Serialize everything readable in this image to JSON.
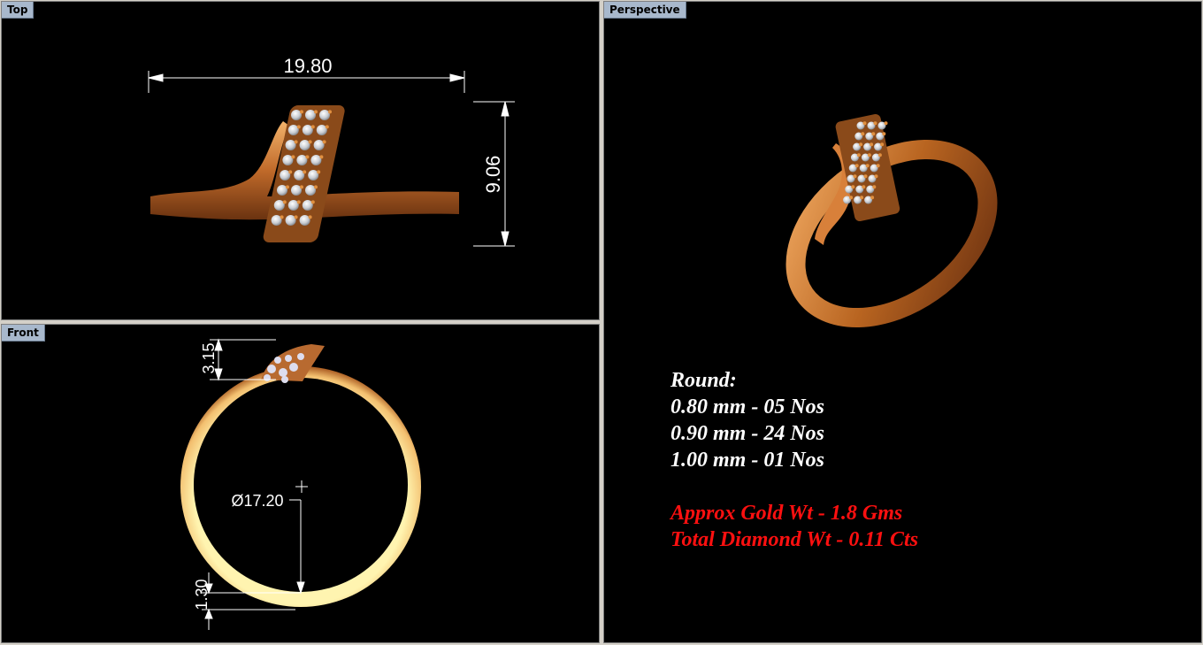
{
  "viewports": {
    "top": {
      "label": "Top"
    },
    "front": {
      "label": "Front"
    },
    "perspective": {
      "label": "Perspective"
    }
  },
  "dimensions": {
    "top_width": "19.80",
    "top_height": "9.06",
    "front_height": "3.15",
    "front_diameter": "Ø17.20",
    "front_thickness": "1.30"
  },
  "specs": {
    "heading": "Round:",
    "lines": [
      "0.80 mm - 05 Nos",
      "0.90 mm - 24 Nos",
      "1.00 mm - 01 Nos"
    ],
    "gold_weight": "Approx Gold Wt - 1.8 Gms",
    "diamond_weight": "Total Diamond Wt - 0.11 Cts"
  },
  "colors": {
    "viewport_bg": "#000000",
    "label_bg": "#a8b8cc",
    "gold": "#c87a3a",
    "highlight_text": "#ff1010"
  }
}
